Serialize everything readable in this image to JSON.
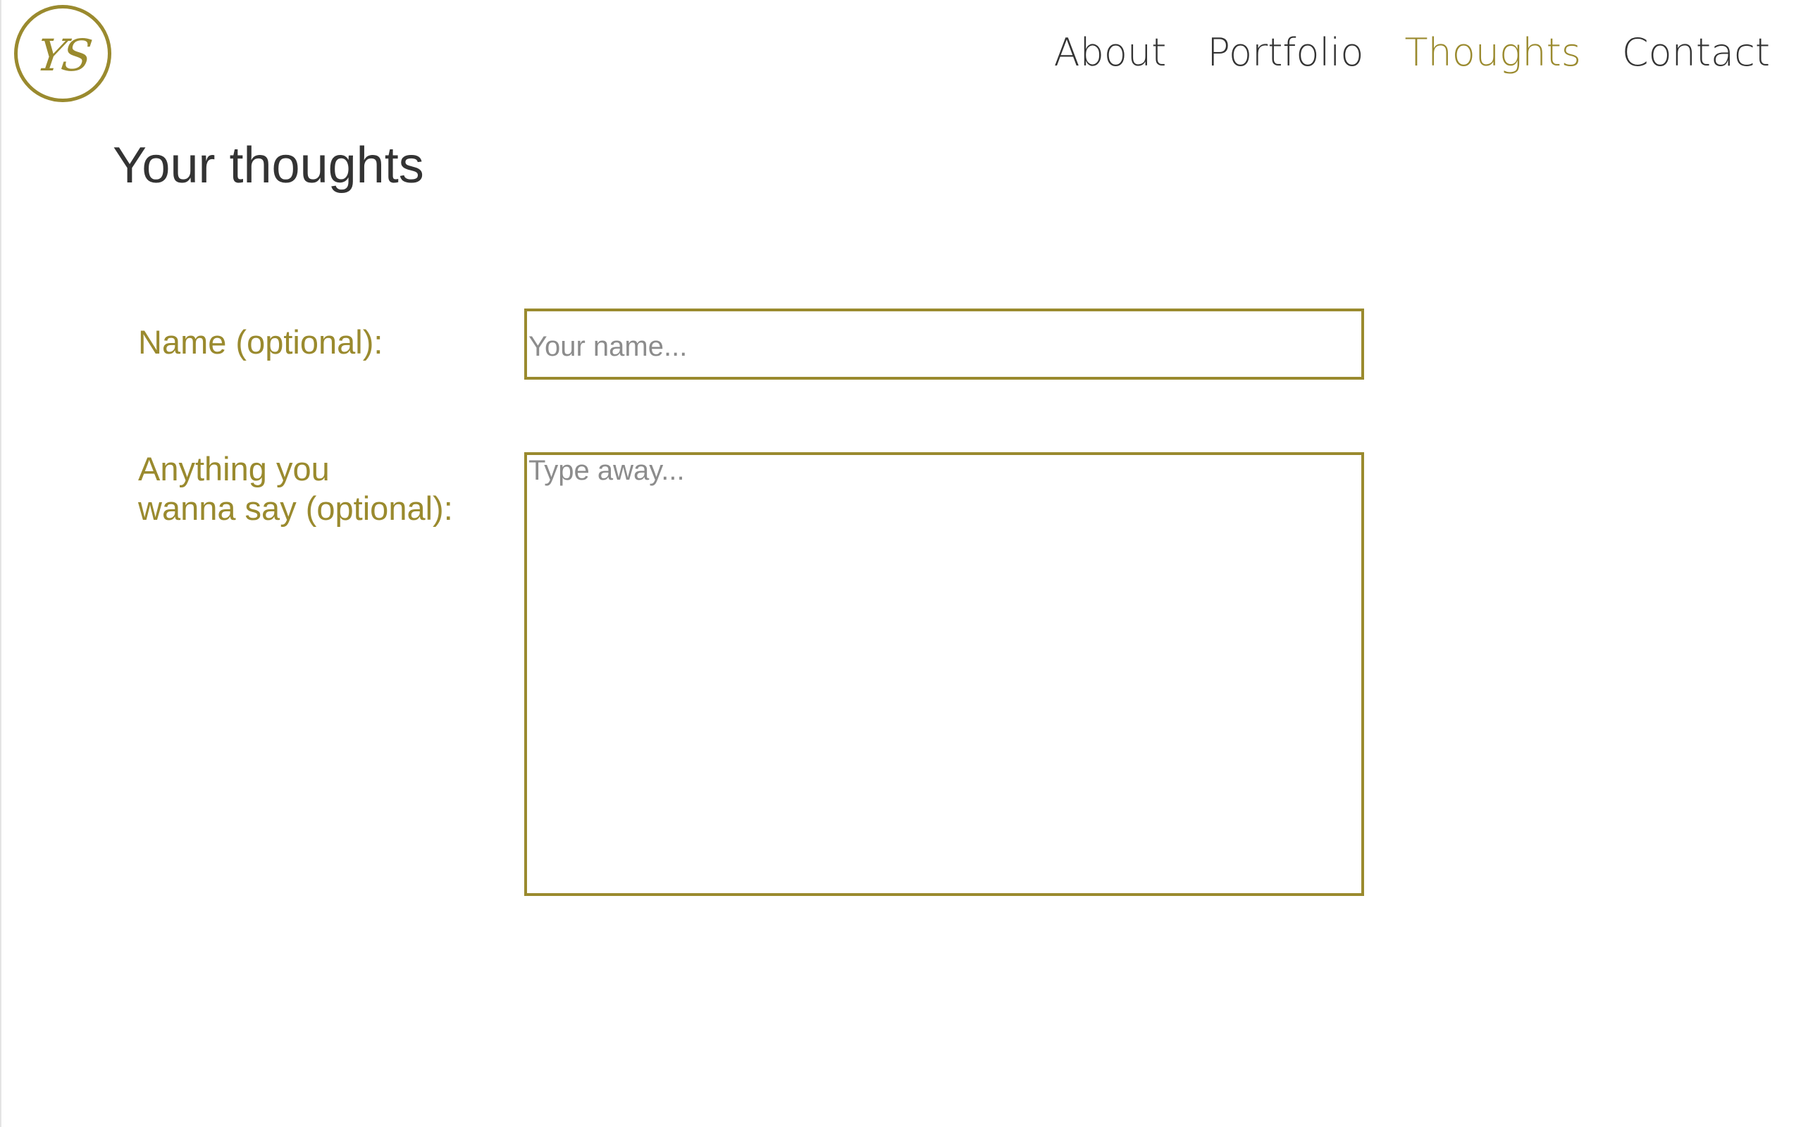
{
  "logo": {
    "monogram": "YS",
    "icon": "ys-monogram-logo",
    "color": "#9a8a2e"
  },
  "nav": {
    "items": [
      {
        "label": "About",
        "active": false
      },
      {
        "label": "Portfolio",
        "active": false
      },
      {
        "label": "Thoughts",
        "active": true
      },
      {
        "label": "Contact",
        "active": false
      }
    ]
  },
  "page": {
    "title": "Your thoughts"
  },
  "form": {
    "name_label": "Name (optional):",
    "name_placeholder": "Your name...",
    "name_value": "",
    "message_label_line1": "Anything you",
    "message_label_line2": "wanna say (optional):",
    "message_placeholder": "Type away...",
    "message_value": ""
  },
  "colors": {
    "accent": "#9a8a2e",
    "text": "#333333",
    "placeholder": "#8c8c8c",
    "background": "#ffffff"
  }
}
